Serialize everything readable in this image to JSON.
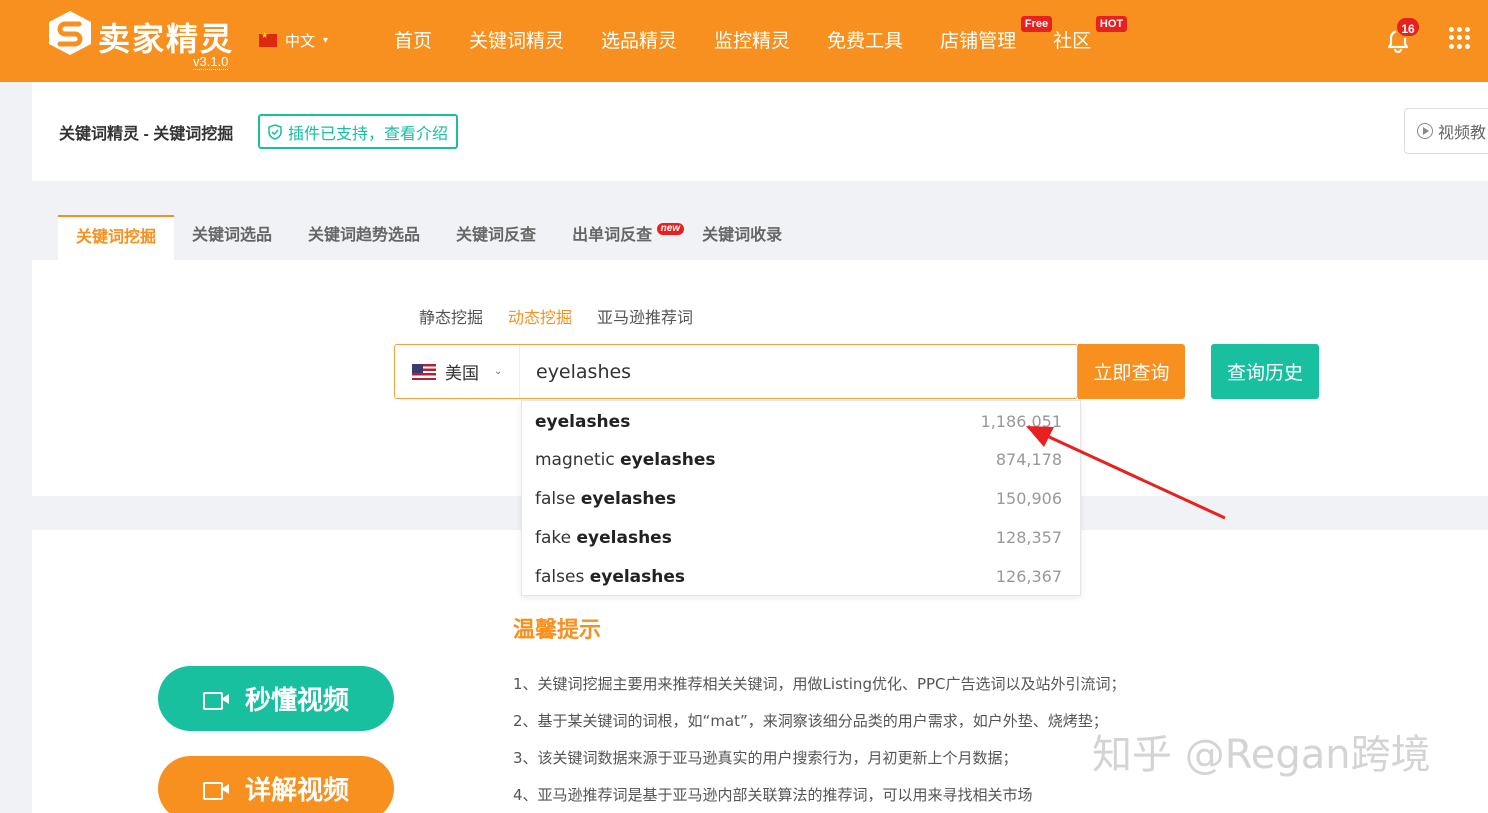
{
  "brand": {
    "name": "卖家精灵",
    "version": "v3.1.0",
    "brand_color": "#f7901e",
    "accent_green": "#18c0a0"
  },
  "language": {
    "label": "中文"
  },
  "nav": [
    {
      "label": "首页",
      "badge": ""
    },
    {
      "label": "关键词精灵",
      "badge": ""
    },
    {
      "label": "选品精灵",
      "badge": ""
    },
    {
      "label": "监控精灵",
      "badge": ""
    },
    {
      "label": "免费工具",
      "badge": ""
    },
    {
      "label": "店铺管理",
      "badge": "Free"
    },
    {
      "label": "社区",
      "badge": "HOT"
    }
  ],
  "notifications": {
    "count": "16"
  },
  "header": {
    "breadcrumb": "关键词精灵 - 关键词挖掘",
    "plugin_tag": "插件已支持，查看介绍",
    "video_tutorial": "视频教"
  },
  "tabs": [
    {
      "label": "关键词挖掘",
      "badge": ""
    },
    {
      "label": "关键词选品",
      "badge": ""
    },
    {
      "label": "关键词趋势选品",
      "badge": ""
    },
    {
      "label": "关键词反查",
      "badge": ""
    },
    {
      "label": "出单词反查",
      "badge": "new"
    },
    {
      "label": "关键词收录",
      "badge": ""
    }
  ],
  "subtabs": [
    "静态挖掘",
    "动态挖掘",
    "亚马逊推荐词"
  ],
  "search": {
    "country": "美国",
    "value": "eyelashes",
    "submit_label": "立即查询",
    "history_label": "查询历史"
  },
  "suggestions": [
    {
      "prefix": "",
      "keyword": "eyelashes",
      "volume": "1,186,051"
    },
    {
      "prefix": "magnetic ",
      "keyword": "eyelashes",
      "volume": "874,178"
    },
    {
      "prefix": "false ",
      "keyword": "eyelashes",
      "volume": "150,906"
    },
    {
      "prefix": "fake ",
      "keyword": "eyelashes",
      "volume": "128,357"
    },
    {
      "prefix": "falses ",
      "keyword": "eyelashes",
      "volume": "126,367"
    }
  ],
  "tips": {
    "title": "温馨提示",
    "items": [
      "1、关键词挖掘主要用来推荐相关关键词，用做Listing优化、PPC广告选词以及站外引流词；",
      "2、基于某关键词的词根，如“mat”，来洞察该细分品类的用户需求，如户外垫、烧烤垫；",
      "3、该关键词数据来源于亚马逊真实的用户搜索行为，月初更新上个月数据；",
      "4、亚马逊推荐词是基于亚马逊内部关联算法的推荐词，可以用来寻找相关市场"
    ]
  },
  "video_buttons": {
    "quick": "秒懂视频",
    "detail": "详解视频"
  },
  "watermark": "知乎 @Regan跨境"
}
